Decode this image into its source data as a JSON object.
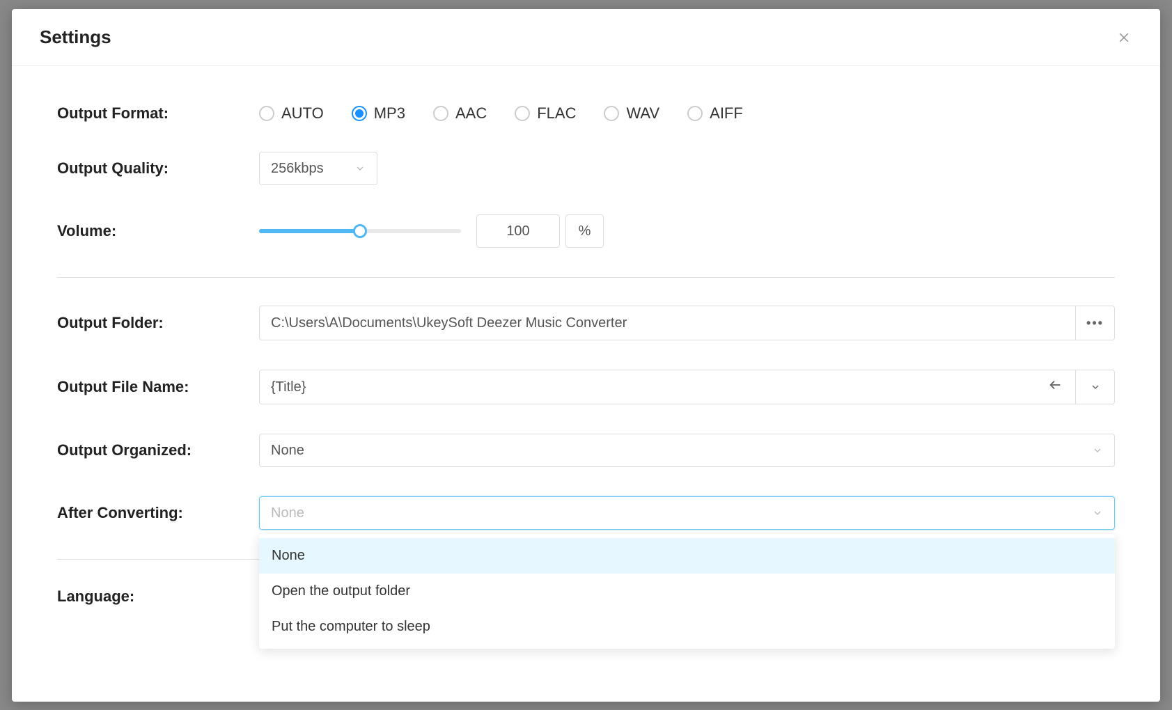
{
  "title": "Settings",
  "labels": {
    "output_format": "Output Format:",
    "output_quality": "Output Quality:",
    "volume": "Volume:",
    "output_folder": "Output Folder:",
    "output_file_name": "Output File Name:",
    "output_organized": "Output Organized:",
    "after_converting": "After Converting:",
    "language": "Language:"
  },
  "output_format": {
    "options": [
      "AUTO",
      "MP3",
      "AAC",
      "FLAC",
      "WAV",
      "AIFF"
    ],
    "selected": "MP3"
  },
  "output_quality": {
    "value": "256kbps"
  },
  "volume": {
    "value": "100",
    "unit": "%",
    "slider_percent": 50
  },
  "output_folder": {
    "value": "C:\\Users\\A\\Documents\\UkeySoft Deezer Music Converter"
  },
  "output_file_name": {
    "value": "{Title}"
  },
  "output_organized": {
    "value": "None"
  },
  "after_converting": {
    "placeholder": "None",
    "options": [
      "None",
      "Open the output folder",
      "Put the computer to sleep"
    ],
    "selected_index": 0
  },
  "language": {
    "value": ""
  }
}
